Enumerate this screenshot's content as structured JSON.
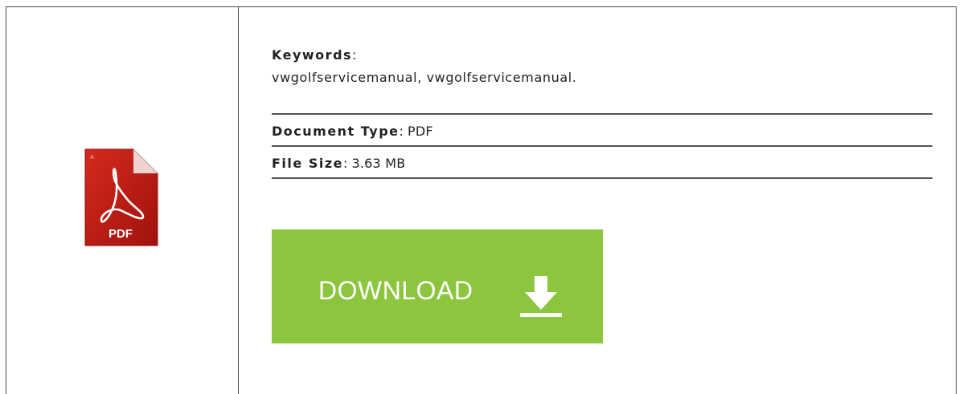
{
  "icon": {
    "name": "pdf-file-icon",
    "label": "PDF"
  },
  "details": {
    "keywords_label": "Keywords",
    "keywords_separator": ":",
    "keywords_value": "vwgolfservicemanual, vwgolfservicemanual.",
    "document_type_label": "Document Type",
    "document_type_value": "PDF",
    "file_size_label": "File Size",
    "file_size_value": "3.63 MB",
    "separator": ":"
  },
  "download": {
    "label": "DOWNLOAD",
    "icon": "download-arrow-icon",
    "color": "#8cc63f"
  }
}
